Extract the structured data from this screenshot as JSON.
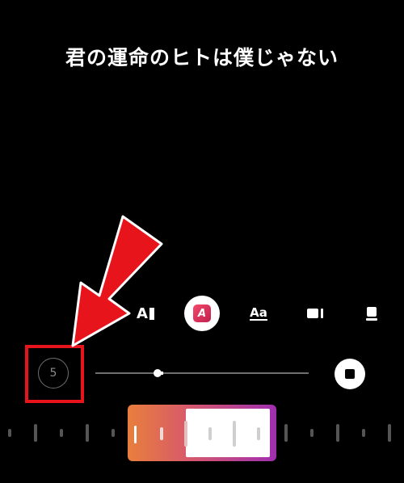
{
  "lyric": {
    "text": "君の運命のヒトは僕じゃない"
  },
  "toolbar": {
    "items": [
      {
        "name": "text-style-bar",
        "glyph": "A"
      },
      {
        "name": "gradient-style",
        "glyph": "A"
      },
      {
        "name": "font-style",
        "glyph": "Aa"
      },
      {
        "name": "layout-side",
        "glyph": ""
      },
      {
        "name": "layout-bottom",
        "glyph": ""
      }
    ]
  },
  "countdown": {
    "value": "5"
  },
  "slider": {
    "fraction": 0.29
  },
  "colors": {
    "background": "#000000",
    "highlight": "#e8141c",
    "gradient_start": "#e87f3c",
    "gradient_end": "#a02eb0"
  },
  "icons": [
    "text-bar-icon",
    "gradient-text-icon",
    "font-icon",
    "layout-side-icon",
    "layout-bottom-icon",
    "stop-icon",
    "arrow-icon"
  ]
}
